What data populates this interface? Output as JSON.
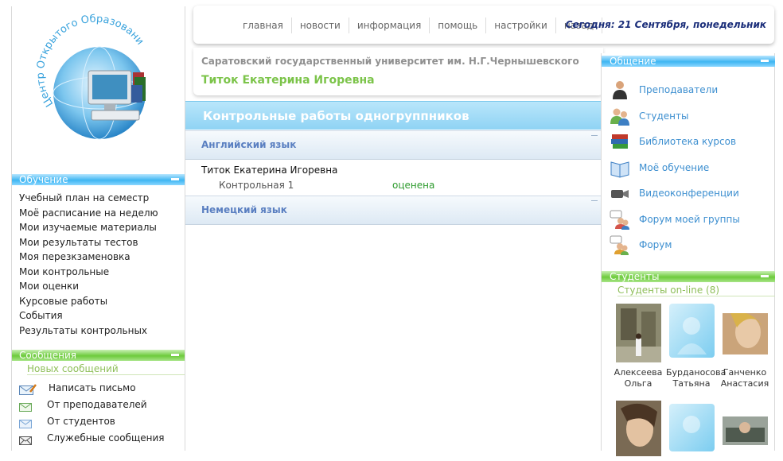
{
  "topnav": {
    "items": [
      "главная",
      "новости",
      "информация",
      "помощь",
      "настройки",
      "назад"
    ],
    "today": "Сегодня: 21 Сентября, понедельник"
  },
  "header": {
    "university": "Саратовский государственный университет им. Н.Г.Чернышевского",
    "user": "Титок Екатерина Игоревна"
  },
  "logo": {
    "text": "Центр Открытого Образования"
  },
  "left": {
    "study_title": "Обучение",
    "study_items": [
      "Учебный план на семестр",
      "Моё расписание на неделю",
      "Мои изучаемые материалы",
      "Мои результаты тестов",
      "Моя перезкзаменовка",
      "Мои контрольные",
      "Мои оценки",
      "Курсовые работы",
      "События",
      "Результаты контрольных"
    ],
    "messages_title": "Сообщения",
    "new_messages": "Новых сообщений",
    "message_items": [
      "Написать письмо",
      "От преподавателей",
      "От студентов",
      "Служебные сообщения"
    ]
  },
  "main": {
    "title": "Контрольные работы одногруппников",
    "subject1": "Английский язык",
    "student": "Титок Екатерина Игоревна",
    "work": "Контрольная 1",
    "status": "оценена",
    "subject2": "Немецкий язык"
  },
  "right": {
    "comm_title": "Общение",
    "comm_items": [
      "Преподаватели",
      "Студенты",
      "Библиотека курсов",
      "Моё обучение",
      "Видеоконференции",
      "Форум моей группы",
      "Форум"
    ],
    "students_title": "Студенты",
    "online": "Студенты on-line (8)",
    "students": [
      {
        "first": "Алексеева",
        "last": "Ольга"
      },
      {
        "first": "Бурданосова",
        "last": "Татьяна"
      },
      {
        "first": "Ганченко",
        "last": "Анастасия"
      }
    ]
  },
  "colors": {
    "blue_bar": "#3fb6f2",
    "green_bar": "#6dcb3c",
    "link_blue": "#3d8fd0",
    "user_green": "#7cc44a",
    "status_green": "#2c9a2c",
    "date_navy": "#1b2e7a"
  }
}
